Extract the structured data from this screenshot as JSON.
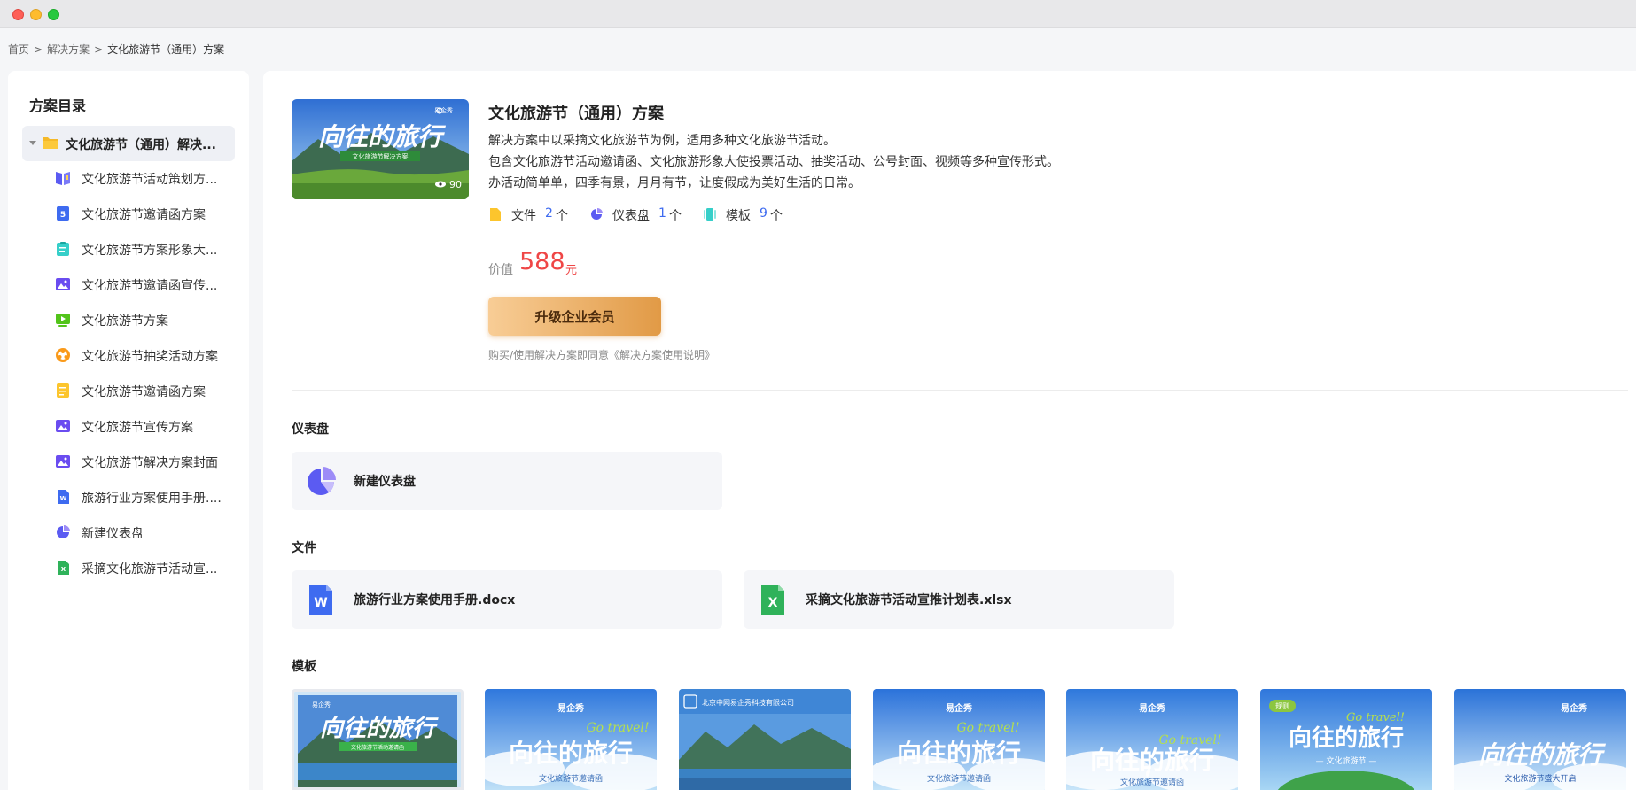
{
  "breadcrumb": {
    "home": "首页",
    "solutions": "解决方案",
    "current": "文化旅游节（通用）方案",
    "sep": ">"
  },
  "sidebar": {
    "title": "方案目录",
    "root": "文化旅游节（通用）解决...",
    "items": [
      {
        "label": "文化旅游节活动策划方...",
        "icon": "book-icon"
      },
      {
        "label": "文化旅游节邀请函方案",
        "icon": "html5-icon"
      },
      {
        "label": "文化旅游节方案形象大...",
        "icon": "clipboard-icon"
      },
      {
        "label": "文化旅游节邀请函宣传...",
        "icon": "image-icon"
      },
      {
        "label": "文化旅游节方案",
        "icon": "video-icon"
      },
      {
        "label": "文化旅游节抽奖活动方案",
        "icon": "lottery-icon"
      },
      {
        "label": "文化旅游节邀请函方案",
        "icon": "document-icon"
      },
      {
        "label": "文化旅游节宣传方案",
        "icon": "image-icon"
      },
      {
        "label": "文化旅游节解决方案封面",
        "icon": "image-icon"
      },
      {
        "label": "旅游行业方案使用手册....",
        "icon": "word-icon"
      },
      {
        "label": "新建仪表盘",
        "icon": "pie-chart-icon"
      },
      {
        "label": "采摘文化旅游节活动宣...",
        "icon": "excel-icon"
      }
    ]
  },
  "solution": {
    "title": "文化旅游节（通用）方案",
    "desc": [
      "解决方案中以采摘文化旅游节为例，适用多种文化旅游节活动。",
      "包含文化旅游节活动邀请函、文化旅游形象大使投票活动、抽奖活动、公号封面、视频等多种宣传形式。",
      "办活动简单单，四季有景，月月有节，让度假成为美好生活的日常。"
    ],
    "cover_title": "向往的旅行",
    "cover_subtitle": "文化旅游节解决方案",
    "cover_brand": "易企秀",
    "views": "90",
    "stats": {
      "files_label": "文件",
      "files_count": "2",
      "dash_label": "仪表盘",
      "dash_count": "1",
      "tpl_label": "模板",
      "tpl_count": "9",
      "unit": "个"
    },
    "price_label": "价值",
    "price_value": "588",
    "price_unit": "元",
    "upgrade_label": "升级企业会员",
    "agree_text": "购买/使用解决方案即同意《解决方案使用说明》"
  },
  "sections": {
    "dashboard_title": "仪表盘",
    "dashboard_card": "新建仪表盘",
    "files_title": "文件",
    "file_cards": [
      "旅游行业方案使用手册.docx",
      "采摘文化旅游节活动宣推计划表.xlsx"
    ],
    "templates_title": "模板"
  },
  "templates": [
    {
      "brand": "易企秀",
      "title": "向往的旅行",
      "subtitle": "文化旅游节活动邀请函"
    },
    {
      "brand": "易企秀",
      "title": "向往的旅行",
      "subtitle": "文化旅游节邀请函",
      "slogan": "Go travel!"
    },
    {
      "brand": "北京中网易企秀科技有限公司",
      "title": "",
      "subtitle": ""
    },
    {
      "brand": "易企秀",
      "title": "向往的旅行",
      "subtitle": "文化旅游节邀请函",
      "slogan": "Go travel!"
    },
    {
      "brand": "易企秀",
      "title": "向往的旅行",
      "subtitle": "文化旅游节邀请函",
      "slogan": "Go travel!"
    },
    {
      "brand": "规则",
      "title": "向往的旅行",
      "subtitle": "— 文化旅游节 —",
      "slogan": "Go travel!"
    },
    {
      "brand": "易企秀",
      "title": "向往的旅行",
      "subtitle": "文化旅游节盛大开启"
    }
  ],
  "colors": {
    "accent": "#3e6bf0",
    "price": "#ef4646",
    "button_start": "#f8cd96",
    "button_end": "#e19a46"
  }
}
